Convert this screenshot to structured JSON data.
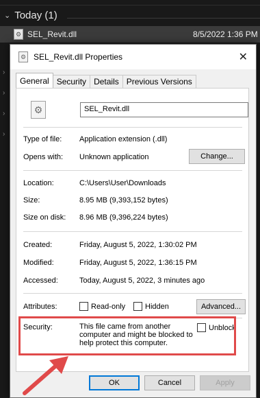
{
  "explorer": {
    "group_label": "Today (1)",
    "file_name": "SEL_Revit.dll",
    "file_date": "8/5/2022 1:36 PM"
  },
  "dialog": {
    "title": "SEL_Revit.dll Properties",
    "tabs": [
      "General",
      "Security",
      "Details",
      "Previous Versions"
    ],
    "file_name_value": "SEL_Revit.dll",
    "fields": {
      "type_label": "Type of file:",
      "type_value": "Application extension (.dll)",
      "opens_label": "Opens with:",
      "opens_value": "Unknown application",
      "change_button": "Change...",
      "location_label": "Location:",
      "location_value": "C:\\Users\\User\\Downloads",
      "size_label": "Size:",
      "size_value": "8.95 MB (9,393,152 bytes)",
      "size_disk_label": "Size on disk:",
      "size_disk_value": "8.96 MB (9,396,224 bytes)",
      "created_label": "Created:",
      "created_value": "Friday, August 5, 2022, 1:30:02 PM",
      "modified_label": "Modified:",
      "modified_value": "Friday, August 5, 2022, 1:36:15 PM",
      "accessed_label": "Accessed:",
      "accessed_value": "Today, August 5, 2022, 3 minutes ago",
      "attributes_label": "Attributes:",
      "readonly_label": "Read-only",
      "hidden_label": "Hidden",
      "advanced_button": "Advanced...",
      "security_label": "Security:",
      "security_text": "This file came from another computer and might be blocked to help protect this computer.",
      "unblock_label": "Unblock"
    },
    "buttons": {
      "ok": "OK",
      "cancel": "Cancel",
      "apply": "Apply"
    }
  },
  "colors": {
    "annotation": "#e04a4a",
    "accent": "#0078d7"
  },
  "icons": [
    "chevron-down-icon",
    "dll-file-icon",
    "close-icon",
    "gear-file-icon",
    "arrow-annotation-icon"
  ]
}
